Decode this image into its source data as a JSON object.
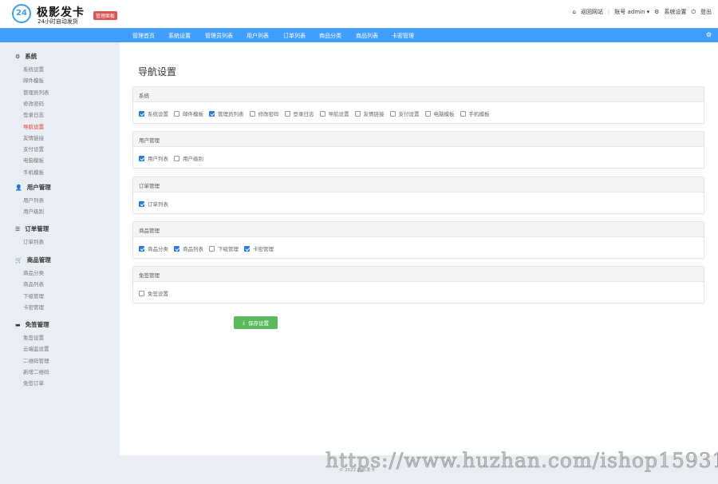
{
  "header": {
    "logo_text": "24",
    "brand": "极影发卡",
    "slogan": "24小时自动发货",
    "badge": "管理面板",
    "return_site": "返回网站",
    "account": "账号 admin",
    "settings": "系统设置",
    "logout": "登出"
  },
  "nav": [
    "管理首页",
    "系统设置",
    "管理员列表",
    "用户列表",
    "订单列表",
    "商品分类",
    "商品列表",
    "卡密管理"
  ],
  "sidebar": [
    {
      "title": "系统",
      "icon": "gear-icon",
      "items": [
        "系统设置",
        "邮件模板",
        "管理员列表",
        "修改密码",
        "登录日志",
        "导航设置",
        "友情链接",
        "支付设置",
        "电脑模板",
        "手机模板"
      ]
    },
    {
      "title": "用户管理",
      "icon": "user-icon",
      "items": [
        "用户列表",
        "用户级别"
      ]
    },
    {
      "title": "订单管理",
      "icon": "list-icon",
      "items": [
        "订单列表"
      ]
    },
    {
      "title": "商品管理",
      "icon": "cart-icon",
      "items": [
        "商品分类",
        "商品列表",
        "下级管理",
        "卡密管理"
      ]
    },
    {
      "title": "免签管理",
      "icon": "card-icon",
      "items": [
        "免签设置",
        "云端监设置",
        "二维码管理",
        "新增二维码",
        "免签订单"
      ]
    }
  ],
  "active_item": "导航设置",
  "page_title": "导航设置",
  "panels": [
    {
      "title": "系统",
      "options": [
        {
          "label": "系统设置",
          "checked": true
        },
        {
          "label": "邮件模板",
          "checked": false
        },
        {
          "label": "管理员列表",
          "checked": true
        },
        {
          "label": "修改密码",
          "checked": false
        },
        {
          "label": "登录日志",
          "checked": false
        },
        {
          "label": "导航设置",
          "checked": false
        },
        {
          "label": "友情链接",
          "checked": false
        },
        {
          "label": "支付设置",
          "checked": false
        },
        {
          "label": "电脑模板",
          "checked": false
        },
        {
          "label": "手机模板",
          "checked": false
        }
      ]
    },
    {
      "title": "用户管理",
      "options": [
        {
          "label": "用户列表",
          "checked": true
        },
        {
          "label": "用户级别",
          "checked": false
        }
      ]
    },
    {
      "title": "订单管理",
      "options": [
        {
          "label": "订单列表",
          "checked": true
        }
      ]
    },
    {
      "title": "商品管理",
      "options": [
        {
          "label": "商品分类",
          "checked": true
        },
        {
          "label": "商品列表",
          "checked": true
        },
        {
          "label": "下级管理",
          "checked": false
        },
        {
          "label": "卡密管理",
          "checked": true
        }
      ]
    },
    {
      "title": "免签管理",
      "options": [
        {
          "label": "免签设置",
          "checked": false
        }
      ]
    }
  ],
  "save_label": "保存设置",
  "footer": "© 2022 极影发卡",
  "watermark": "https://www.huzhan.com/ishop15931",
  "colors": {
    "nav": "#409eff",
    "active": "#e53935",
    "save": "#5cb85c",
    "checkbox": "#2a7de1"
  }
}
